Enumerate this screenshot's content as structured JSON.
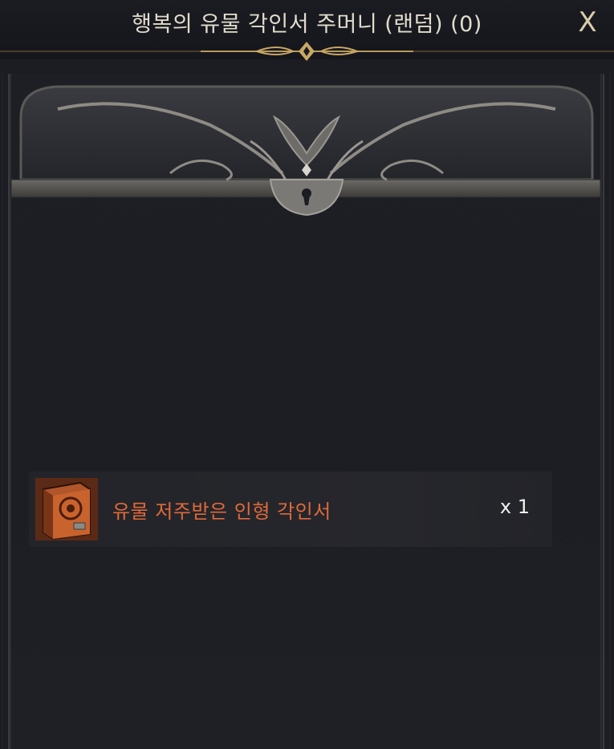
{
  "window": {
    "title": "행복의 유물 각인서 주머니 (랜덤) (0)",
    "close_label": "X"
  },
  "reward_list": {
    "items": [
      {
        "name": "유물 저주받은 인형 각인서",
        "quantity": "x 1",
        "name_color": "#e0693a",
        "icon": "engraving-book-icon"
      }
    ]
  }
}
